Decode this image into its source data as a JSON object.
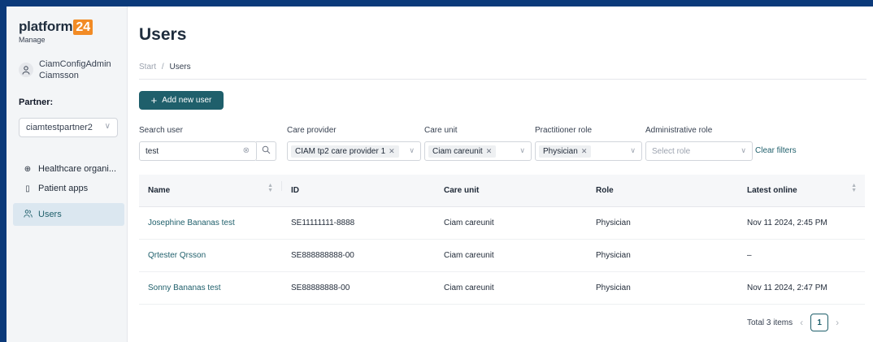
{
  "brand": {
    "name": "platform",
    "number": "24",
    "subtitle": "Manage",
    "accent": "#f28b25"
  },
  "user": {
    "avatar_icon": "person-icon",
    "name": "CiamConfigAdmin Ciamsson"
  },
  "partner": {
    "label": "Partner:",
    "value": "ciamtestpartner2"
  },
  "nav": [
    {
      "label": "Healthcare organi...",
      "icon": "organization-icon"
    },
    {
      "label": "Patient apps",
      "icon": "phone-icon"
    },
    {
      "label": "Users",
      "icon": "users-icon",
      "active": true
    }
  ],
  "page": {
    "title": "Users",
    "breadcrumb": {
      "start": "Start",
      "sep": "/",
      "current": "Users"
    },
    "add_button": "Add new user"
  },
  "filters": {
    "search": {
      "label": "Search user",
      "value": "test"
    },
    "care_provider": {
      "label": "Care provider",
      "tag": "CIAM tp2 care provider 1"
    },
    "care_unit": {
      "label": "Care unit",
      "tag": "Ciam careunit"
    },
    "practitioner_role": {
      "label": "Practitioner role",
      "tag": "Physician"
    },
    "administrative_role": {
      "label": "Administrative role",
      "placeholder": "Select role"
    },
    "clear": "Clear filters"
  },
  "table": {
    "columns": [
      "Name",
      "ID",
      "Care unit",
      "Role",
      "Latest online"
    ],
    "rows": [
      {
        "name": "Josephine Bananas test",
        "id": "SE11111111-8888",
        "care_unit": "Ciam careunit",
        "role": "Physician",
        "latest": "Nov 11 2024, 2:45 PM"
      },
      {
        "name": "Qrtester Qrsson",
        "id": "SE888888888-00",
        "care_unit": "Ciam careunit",
        "role": "Physician",
        "latest": "–"
      },
      {
        "name": "Sonny Bananas test",
        "id": "SE88888888-00",
        "care_unit": "Ciam careunit",
        "role": "Physician",
        "latest": "Nov 11 2024, 2:47 PM"
      }
    ]
  },
  "pagination": {
    "total": "Total 3 items",
    "current_page": "1"
  },
  "colors": {
    "primary": "#1f5f6b",
    "frame": "#0b3a7a"
  }
}
